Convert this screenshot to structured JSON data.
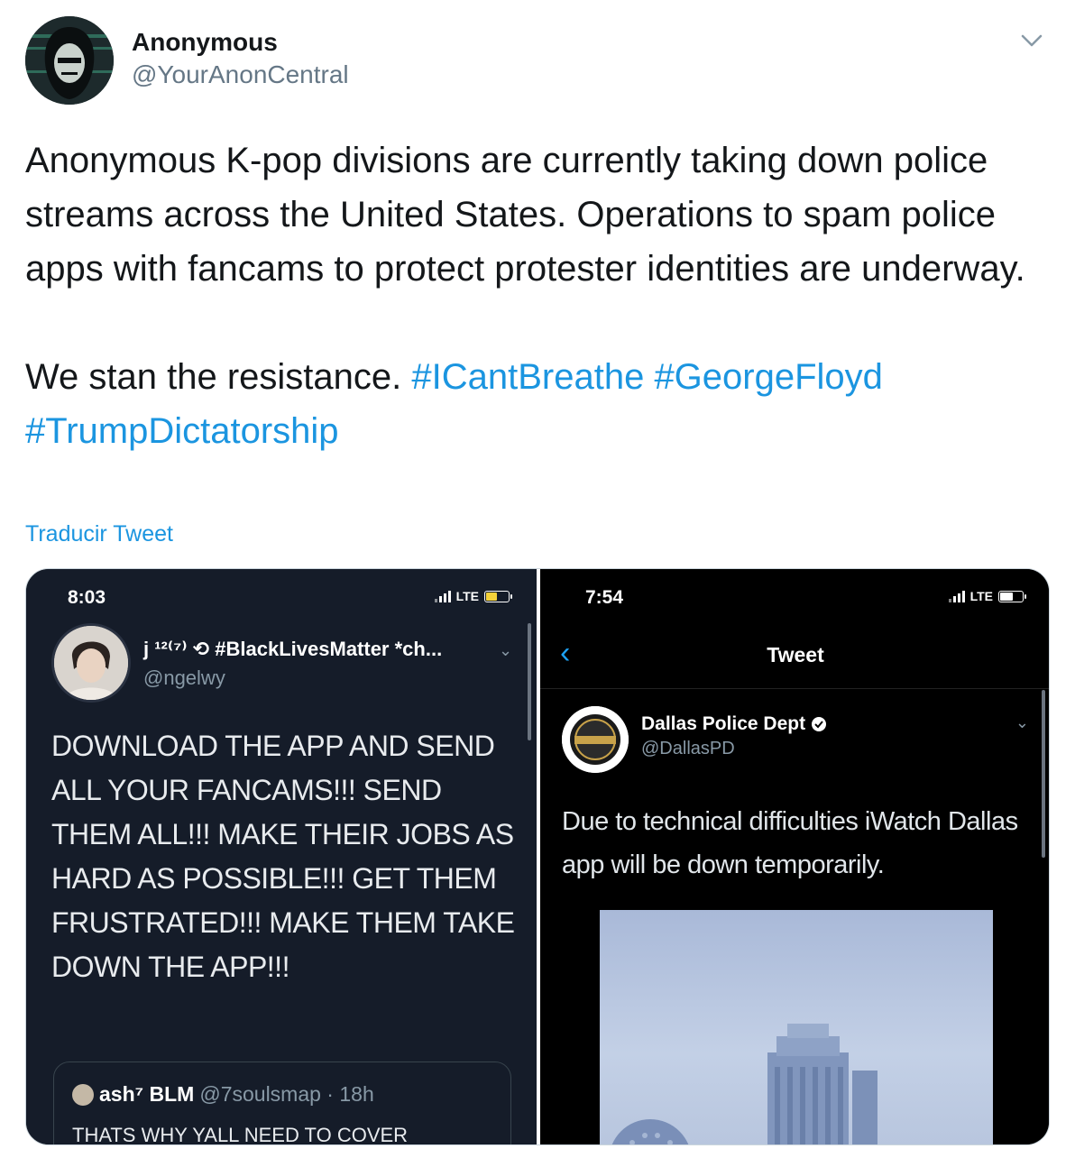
{
  "author": {
    "name": "Anonymous",
    "handle": "@YourAnonCentral"
  },
  "tweet": {
    "line1": "Anonymous K-pop divisions are currently taking down police streams across the United States. Operations to spam police apps with fancams to protect protester identities are underway.",
    "line2_text": "We stan the resistance. ",
    "hashtags": [
      "#ICantBreathe",
      "#GeorgeFloyd",
      "#TrumpDictatorship"
    ],
    "translate_label": "Traducir Tweet"
  },
  "colors": {
    "link": "#1b95e0",
    "text": "#14171a",
    "muted": "#657786",
    "battery_left": "#f5d23a",
    "battery_right": "#ffffff"
  },
  "screenshot_left": {
    "time": "8:03",
    "carrier": "LTE",
    "name": "j ¹²⁽⁷⁾ ⟲ #BlackLivesMatter *ch...",
    "handle": "@ngelwy",
    "body": "DOWNLOAD THE APP AND SEND ALL YOUR FANCAMS!!! SEND THEM ALL!!! MAKE THEIR JOBS AS HARD AS POSSIBLE!!! GET THEM FRUSTRATED!!! MAKE THEM TAKE DOWN THE APP!!!",
    "quote": {
      "name": "ash⁷ BLM",
      "handle": "@7soulsmap · 18h",
      "text": "THATS WHY YALL NEED TO COVER"
    }
  },
  "screenshot_right": {
    "time": "7:54",
    "carrier": "LTE",
    "title": "Tweet",
    "name": "Dallas Police Dept",
    "handle": "@DallasPD",
    "body": "Due to technical difficulties iWatch Dallas app will be down temporarily."
  }
}
